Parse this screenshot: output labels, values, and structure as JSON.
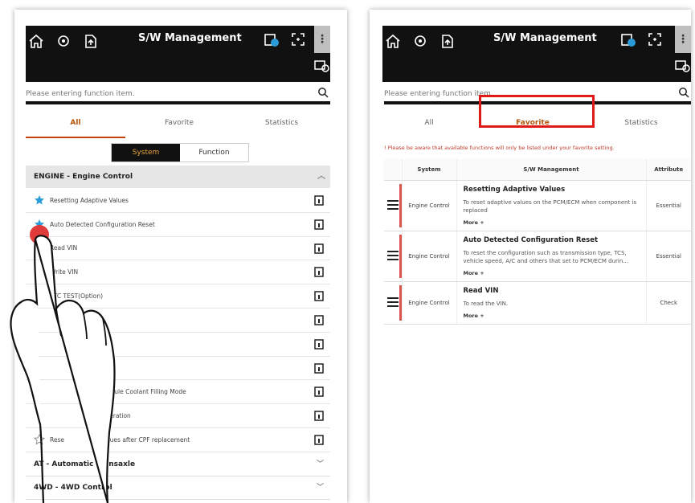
{
  "left_panel": {
    "title": "S/W Management",
    "search_placeholder": "Please entering function item.",
    "tabs": [
      "All",
      "Favorite",
      "Statistics"
    ],
    "segment": {
      "system": "System",
      "function": "Function"
    },
    "group": "ENGINE - Engine Control",
    "items": [
      {
        "label": "Resetting Adaptive Values",
        "fav": true
      },
      {
        "label": "Auto Detected Configuration Reset",
        "fav": true
      },
      {
        "label": "Read VIN",
        "fav": false
      },
      {
        "label": "Write VIN",
        "fav": false
      },
      {
        "label": "ETC TEST(Option)",
        "fav": false
      },
      {
        "label": "",
        "fav": false
      },
      {
        "label": "lues",
        "fav": false
      },
      {
        "label": "",
        "fav": false
      },
      {
        "label": "l Module Coolant Filling Mode",
        "fav": false
      },
      {
        "label": "generation",
        "fav": false
      },
      {
        "label": "ve Values after CPF replacement",
        "fav": false
      }
    ],
    "last_item_prefix": "Rese",
    "sections": [
      "AT - Automatic Transaxle",
      "4WD - 4WD Control"
    ]
  },
  "right_panel": {
    "title": "S/W Management",
    "search_placeholder": "Please entering function item.",
    "tabs": [
      "All",
      "Favorite",
      "Statistics"
    ],
    "notice": "! Please be aware that available functions will only be listed under your favorite setting.",
    "columns": {
      "system": "System",
      "sw": "S/W Management",
      "attribute": "Attribute"
    },
    "rows": [
      {
        "system": "Engine Control",
        "title": "Resetting Adaptive Values",
        "desc": "To reset adaptive values on the PCM/ECM when component is replaced",
        "more": "More +",
        "attribute": "Essential"
      },
      {
        "system": "Engine Control",
        "title": "Auto Detected Configuration Reset",
        "desc": "To reset the configuration such as transmission type, TCS, vehicle speed, A/C and others that set to PCM/ECM durin...",
        "more": "More +",
        "attribute": "Essential"
      },
      {
        "system": "Engine Control",
        "title": "Read VIN",
        "desc": "To read the VIN.",
        "more": "More +",
        "attribute": "Check"
      }
    ]
  },
  "colors": {
    "accent": "#c2410c",
    "highlight": "#e01919",
    "topbar": "#111111",
    "star": "#2b9cd8"
  }
}
